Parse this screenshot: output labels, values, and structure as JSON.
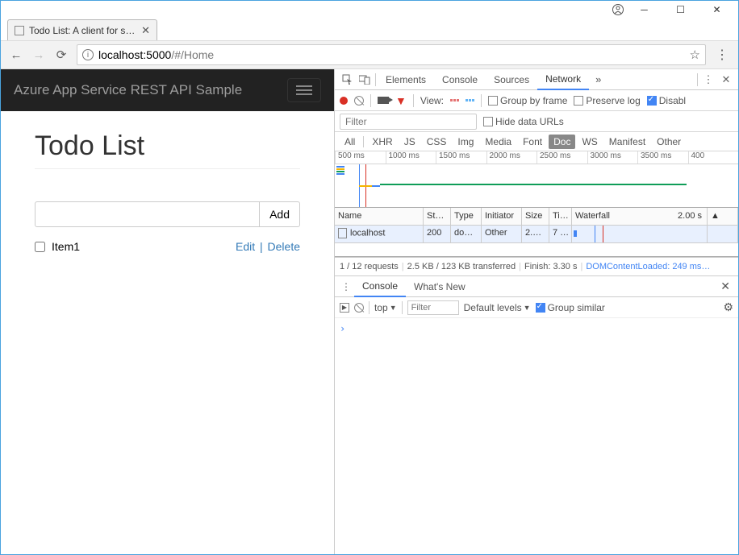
{
  "window": {
    "tab_title": "Todo List: A client for sam"
  },
  "toolbar": {
    "url_host": "localhost",
    "url_port": ":5000",
    "url_path": "/#/Home"
  },
  "page": {
    "brand": "Azure App Service REST API Sample",
    "title": "Todo List",
    "add_label": "Add",
    "item_label": "Item1",
    "edit_label": "Edit",
    "delete_label": "Delete",
    "sep": "|"
  },
  "devtools": {
    "tabs": {
      "elements": "Elements",
      "console": "Console",
      "sources": "Sources",
      "network": "Network"
    },
    "net_toolbar": {
      "view_label": "View:",
      "group_by_frame": "Group by frame",
      "preserve_log": "Preserve log",
      "disable": "Disabl"
    },
    "filter_placeholder": "Filter",
    "hide_urls": "Hide data URLs",
    "type_filters": {
      "all": "All",
      "xhr": "XHR",
      "js": "JS",
      "css": "CSS",
      "img": "Img",
      "media": "Media",
      "font": "Font",
      "doc": "Doc",
      "ws": "WS",
      "manifest": "Manifest",
      "other": "Other"
    },
    "timeline_ticks": [
      "500 ms",
      "1000 ms",
      "1500 ms",
      "2000 ms",
      "2500 ms",
      "3000 ms",
      "3500 ms",
      "400"
    ],
    "columns": {
      "name": "Name",
      "status": "St…",
      "type": "Type",
      "initiator": "Initiator",
      "size": "Size",
      "time": "Ti…",
      "waterfall": "Waterfall",
      "wf_time": "2.00 s"
    },
    "rows": [
      {
        "name": "localhost",
        "status": "200",
        "type": "do…",
        "initiator": "Other",
        "size": "2.…",
        "time": "7 …"
      }
    ],
    "status": {
      "requests": "1 / 12 requests",
      "transferred": "2.5 KB / 123 KB transferred",
      "finish": "Finish: 3.30 s",
      "dcl": "DOMContentLoaded: 249 ms…"
    },
    "drawer": {
      "console_tab": "Console",
      "whatsnew_tab": "What's New",
      "context": "top",
      "filter_placeholder": "Filter",
      "levels": "Default levels",
      "group_similar": "Group similar"
    }
  }
}
